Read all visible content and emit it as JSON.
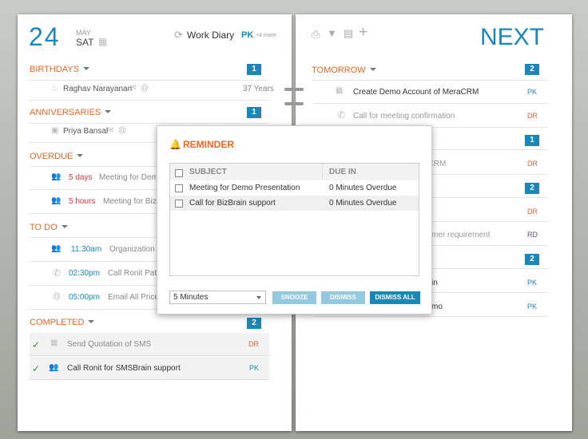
{
  "header": {
    "day": "24",
    "month": "MAY",
    "weekday": "SAT",
    "title": "Work Diary",
    "user": "PK",
    "more": "+4 more"
  },
  "next_title": "NEXT",
  "toolbar": [
    "print-icon",
    "filter-icon",
    "export-icon",
    "add-icon"
  ],
  "left": {
    "birthdays": {
      "label": "BIRTHDAYS",
      "count": "1",
      "items": [
        {
          "name": "Raghav Narayanan",
          "age": "37 Years"
        }
      ]
    },
    "anniversaries": {
      "label": "ANNIVERSARIES",
      "count": "1",
      "items": [
        {
          "name": "Priya Bansal"
        }
      ]
    },
    "overdue": {
      "label": "OVERDUE",
      "items": [
        {
          "time": "5 days",
          "text": "Meeting for Demo"
        },
        {
          "time": "5 hours",
          "text": "Meeting for BizB"
        }
      ]
    },
    "todo": {
      "label": "TO DO",
      "items": [
        {
          "time": "11:30am",
          "text": "Organization V"
        },
        {
          "time": "02:30pm",
          "text": "Call Ronit Patel"
        },
        {
          "time": "05:00pm",
          "text": "Email All Prices"
        }
      ]
    },
    "completed": {
      "label": "COMPLETED",
      "count": "2",
      "items": [
        {
          "text": "Send Quotation of SMS",
          "user": "DR"
        },
        {
          "text": "Call Ronit for SMSBrain support",
          "user": "PK"
        }
      ]
    }
  },
  "right": {
    "tomorrow": {
      "label": "TOMORROW",
      "count": "2",
      "items": [
        {
          "text": "Create Demo Account of MeraCRM",
          "user": "PK"
        },
        {
          "text": "Call for meeting confirmation",
          "user": "DR"
        }
      ]
    },
    "group2": {
      "count": "1",
      "items": [
        {
          "text": "aCRM",
          "user": "DR"
        }
      ]
    },
    "group3": {
      "count": "2",
      "items": [
        {
          "text": "",
          "user": "DR"
        },
        {
          "text": "mer requirement",
          "user": "RD"
        }
      ]
    },
    "group4": {
      "count": "2",
      "items": [
        {
          "text": "in",
          "user": "PK"
        },
        {
          "text": "mo",
          "user": "PK"
        }
      ]
    }
  },
  "reminder": {
    "title": "REMINDER",
    "col_subject": "SUBJECT",
    "col_due": "DUE IN",
    "rows": [
      {
        "subject": "Meeting for Demo Presentation",
        "due": "0 Minutes Overdue"
      },
      {
        "subject": "Call for BizBrain support",
        "due": "0 Minutes Overdue"
      }
    ],
    "snooze_value": "5 Minutes",
    "snooze": "SNOOZE",
    "dismiss": "DISMISS",
    "dismiss_all": "DISMISS ALL"
  },
  "colors": {
    "accent": "#1a87b8",
    "section": "#f26522"
  }
}
